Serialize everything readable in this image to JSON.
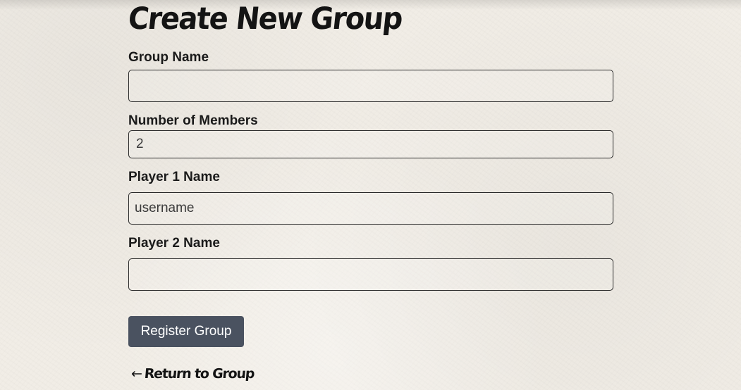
{
  "page": {
    "title": "Create New Group"
  },
  "form": {
    "group_name": {
      "label": "Group Name",
      "value": ""
    },
    "member_count": {
      "label": "Number of Members",
      "value": "2"
    },
    "player1": {
      "label": "Player 1 Name",
      "value": "username"
    },
    "player2": {
      "label": "Player 2 Name",
      "value": ""
    },
    "submit_label": "Register Group"
  },
  "footer": {
    "return_arrow": "←",
    "return_label": "Return to Group"
  },
  "colors": {
    "background": "#f1ede6",
    "button": "#4a5260",
    "button_text": "#ffffff",
    "text": "#1a1a1a"
  }
}
